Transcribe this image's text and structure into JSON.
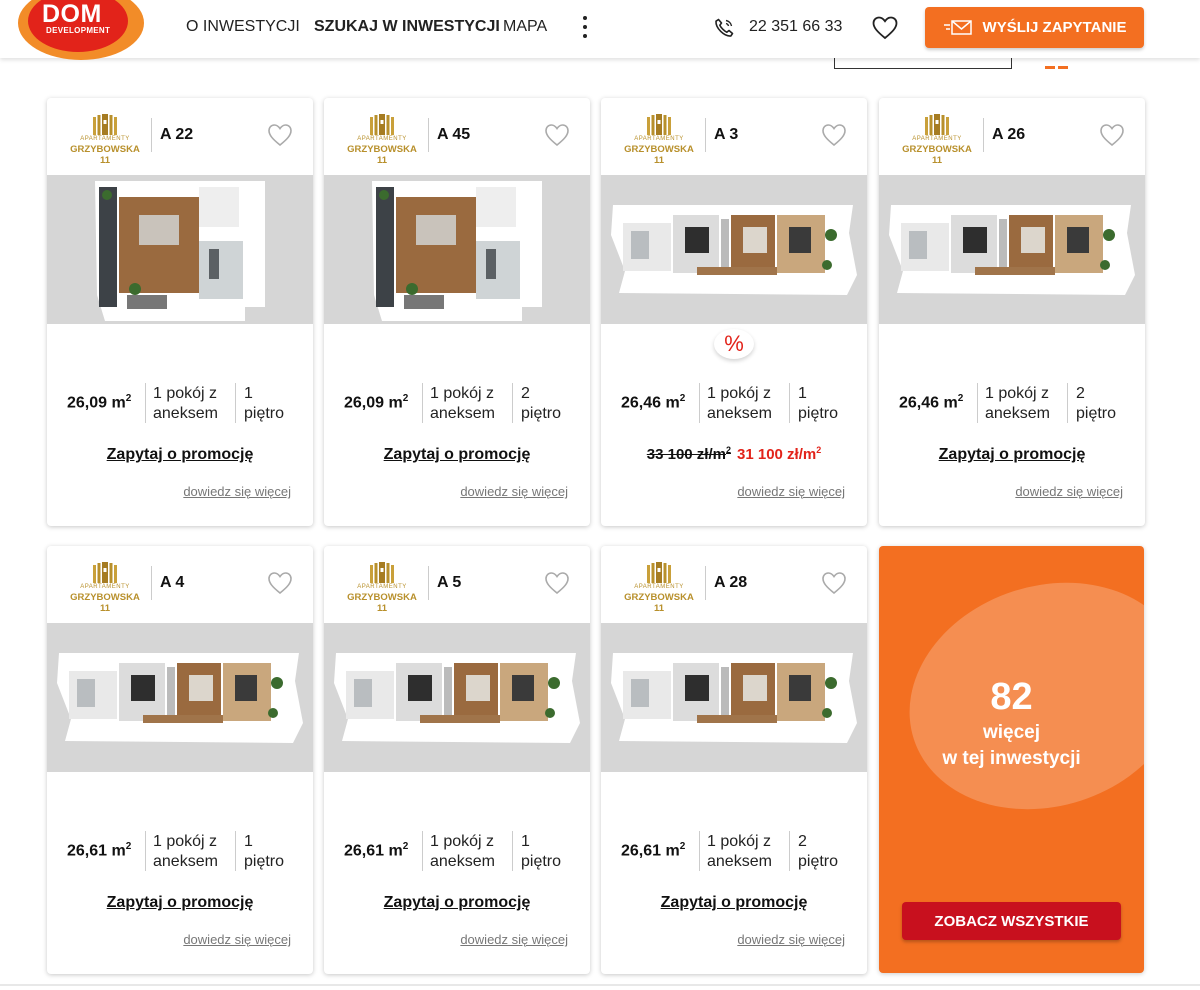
{
  "header": {
    "logo": {
      "main": "DOM",
      "sub": "DEVELOPMENT"
    },
    "nav": [
      {
        "label": "O INWESTYCJI",
        "active": false
      },
      {
        "label": "SZUKAJ W INWESTYCJI",
        "active": true
      },
      {
        "label": "MAPA",
        "active": false
      }
    ],
    "phone": "22 351 66 33",
    "cta_label": "WYŚLIJ ZAPYTANIE"
  },
  "brand": {
    "sub": "APARTAMENTY",
    "main": "GRZYBOWSKA 11",
    "color": "#b8902c"
  },
  "cards": [
    {
      "code": "A 22",
      "area": "26,09 m",
      "area_unit_sup": "2",
      "rooms_line1": "1 pokój z",
      "rooms_line2": "aneksem",
      "floor_line1": "1",
      "floor_line2": "piętro",
      "promo_label": "Zapytaj o promocję",
      "more_label": "dowiedz się więcej",
      "plan": "square"
    },
    {
      "code": "A 45",
      "area": "26,09 m",
      "area_unit_sup": "2",
      "rooms_line1": "1 pokój z",
      "rooms_line2": "aneksem",
      "floor_line1": "2",
      "floor_line2": "piętro",
      "promo_label": "Zapytaj o promocję",
      "more_label": "dowiedz się więcej",
      "plan": "square"
    },
    {
      "code": "A 3",
      "area": "26,46 m",
      "area_unit_sup": "2",
      "rooms_line1": "1 pokój z",
      "rooms_line2": "aneksem",
      "floor_line1": "1",
      "floor_line2": "piętro",
      "promo_badge": "%",
      "price_old": "33 100 zł/m",
      "price_new": "31 100 zł/m",
      "price_sup": "2",
      "more_label": "dowiedz się więcej",
      "plan": "wide"
    },
    {
      "code": "A 26",
      "area": "26,46 m",
      "area_unit_sup": "2",
      "rooms_line1": "1 pokój z",
      "rooms_line2": "aneksem",
      "floor_line1": "2",
      "floor_line2": "piętro",
      "promo_label": "Zapytaj o promocję",
      "more_label": "dowiedz się więcej",
      "plan": "wide"
    },
    {
      "code": "A 4",
      "area": "26,61 m",
      "area_unit_sup": "2",
      "rooms_line1": "1 pokój z",
      "rooms_line2": "aneksem",
      "floor_line1": "1",
      "floor_line2": "piętro",
      "promo_label": "Zapytaj o promocję",
      "more_label": "dowiedz się więcej",
      "plan": "wide"
    },
    {
      "code": "A 5",
      "area": "26,61 m",
      "area_unit_sup": "2",
      "rooms_line1": "1 pokój z",
      "rooms_line2": "aneksem",
      "floor_line1": "1",
      "floor_line2": "piętro",
      "promo_label": "Zapytaj o promocję",
      "more_label": "dowiedz się więcej",
      "plan": "wide"
    },
    {
      "code": "A 28",
      "area": "26,61 m",
      "area_unit_sup": "2",
      "rooms_line1": "1 pokój z",
      "rooms_line2": "aneksem",
      "floor_line1": "2",
      "floor_line2": "piętro",
      "promo_label": "Zapytaj o promocję",
      "more_label": "dowiedz się więcej",
      "plan": "wide"
    }
  ],
  "summary": {
    "count": "82",
    "line1": "więcej",
    "line2": "w tej inwestycji",
    "button_label": "ZOBACZ WSZYSTKIE"
  },
  "icons": {
    "phone": "phone-icon",
    "favorite": "heart-icon",
    "send": "envelope-send-icon",
    "more": "vertical-dots-icon",
    "promo": "percent-icon"
  },
  "colors": {
    "accent": "#f36f21",
    "brand_red": "#e2231a",
    "button_dark_red": "#c8101e",
    "price_promo": "#e2231a"
  }
}
